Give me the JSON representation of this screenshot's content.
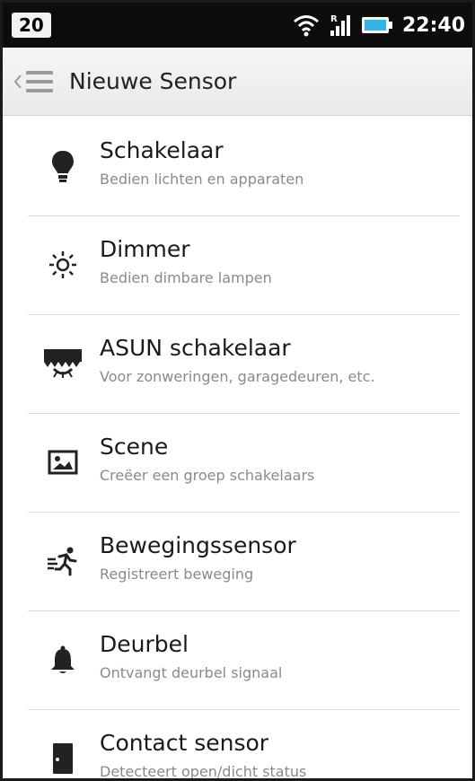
{
  "status_bar": {
    "notification_count": "20",
    "time": "22:40",
    "signal_label": "R",
    "icons": [
      "wifi-icon",
      "signal-icon",
      "battery-icon"
    ]
  },
  "action_bar": {
    "title": "Nieuwe Sensor",
    "icons": [
      "up-caret-icon",
      "menu-icon"
    ]
  },
  "items": [
    {
      "title": "Schakelaar",
      "subtitle": "Bedien lichten en apparaten",
      "icon": "lightbulb-icon"
    },
    {
      "title": "Dimmer",
      "subtitle": "Bedien dimbare lampen",
      "icon": "sun-icon"
    },
    {
      "title": "ASUN schakelaar",
      "subtitle": "Voor zonweringen, garagedeuren, etc.",
      "icon": "awning-icon"
    },
    {
      "title": "Scene",
      "subtitle": "Creëer een groep schakelaars",
      "icon": "picture-icon"
    },
    {
      "title": "Bewegingssensor",
      "subtitle": "Registreert beweging",
      "icon": "running-person-icon"
    },
    {
      "title": "Deurbel",
      "subtitle": "Ontvangt deurbel signaal",
      "icon": "bell-icon"
    },
    {
      "title": "Contact sensor",
      "subtitle": "Detecteert open/dicht status",
      "icon": "door-icon"
    }
  ],
  "colors": {
    "status_bar_bg": "#0d0d0d",
    "action_bar_bg": "#efefef",
    "battery_accent": "#33b5e5",
    "title_text": "#1a1a1a",
    "subtitle_text": "#8a8a8a",
    "icon_color": "#222222"
  }
}
